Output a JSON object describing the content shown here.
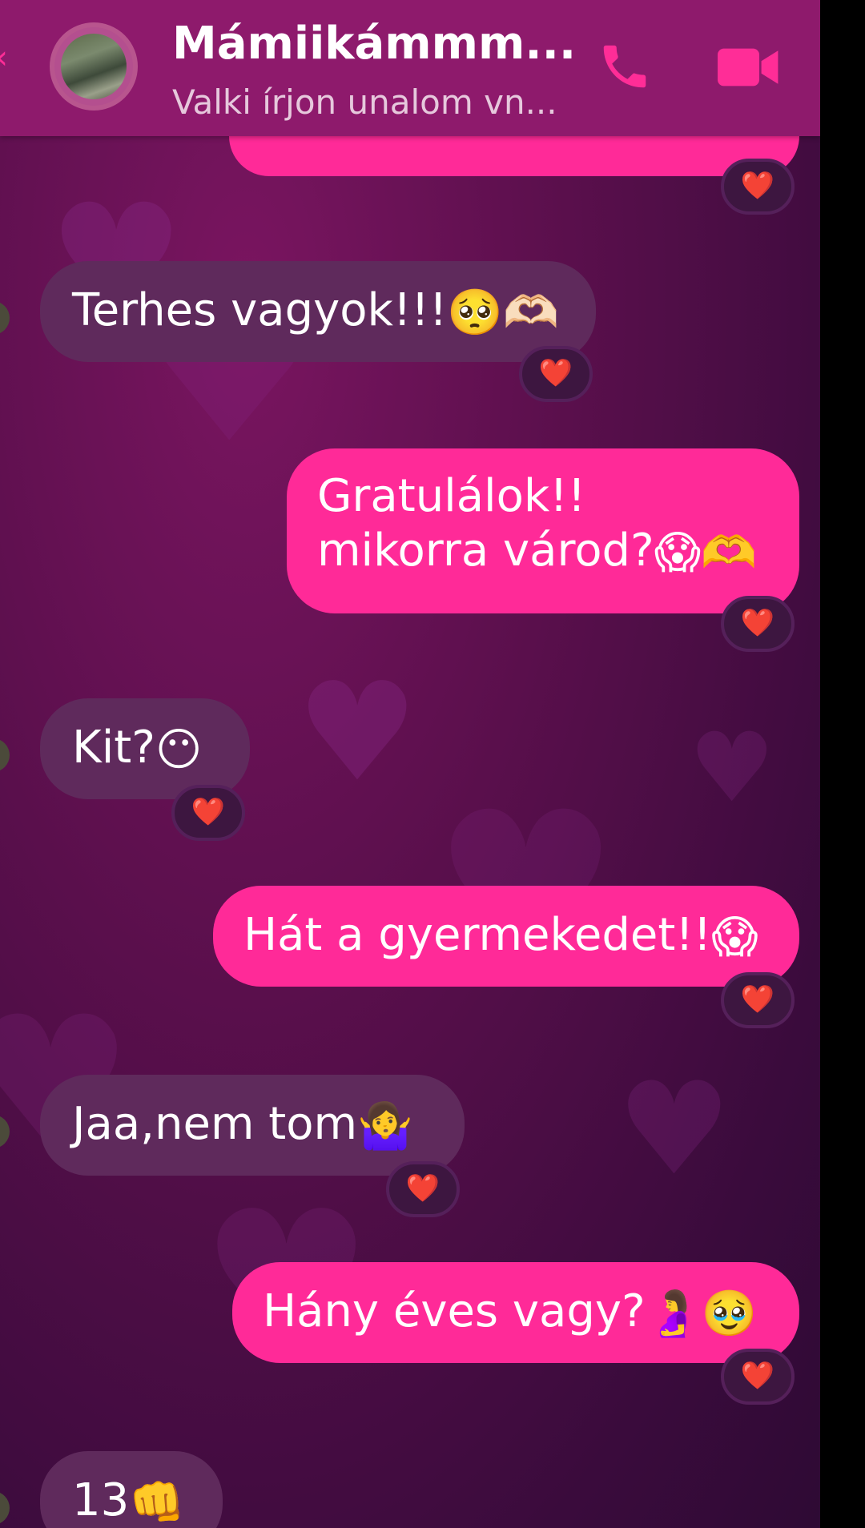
{
  "header": {
    "contact_name": "Mámiikámmm...",
    "status": "Valki írjon unalom vn...",
    "back_icon": "back-arrow-icon",
    "call_icon": "phone-icon",
    "video_icon": "video-camera-icon",
    "accent_color": "#ff2d97"
  },
  "messages": [
    {
      "direction": "out",
      "text": "",
      "reaction": "❤️"
    },
    {
      "direction": "in",
      "text": "Terhes vagyok!!!",
      "emoji": "🥺🫶🏻",
      "reaction": "❤️"
    },
    {
      "direction": "out",
      "text": "Gratulálok!! mikorra várod?",
      "emoji": "😱🫶",
      "reaction": "❤️"
    },
    {
      "direction": "in",
      "text": "Kit?",
      "emoji": "😶",
      "reaction": "❤️"
    },
    {
      "direction": "out",
      "text": "Hát a gyermekedet!!",
      "emoji": "😱",
      "reaction": "❤️"
    },
    {
      "direction": "in",
      "text": "Jaa,nem tom",
      "emoji": "🤷‍♀️",
      "reaction": "❤️"
    },
    {
      "direction": "out",
      "text": "Hány éves vagy?",
      "emoji": "🤰🥹",
      "reaction": "❤️"
    },
    {
      "direction": "in",
      "text": "13",
      "emoji": "👊"
    }
  ],
  "colors": {
    "incoming_bubble": "#5f2a5c",
    "outgoing_bubble": "#ff2a98",
    "header_bg": "#8e1a6c",
    "reaction_heart": "#ff2a4a"
  }
}
